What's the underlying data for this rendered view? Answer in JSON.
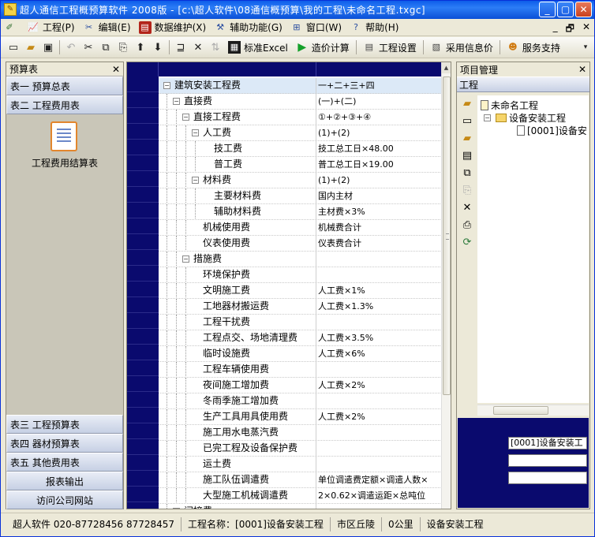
{
  "window": {
    "title": "超人通信工程概预算软件 2008版 - [c:\\超人软件\\08通信概预算\\我的工程\\未命名工程.txgc]",
    "icon": "app-icon"
  },
  "menu": {
    "items": [
      {
        "label": "工程(P)",
        "icon": "project-icon"
      },
      {
        "label": "编辑(E)",
        "icon": "edit-icon"
      },
      {
        "label": "数据维护(X)",
        "icon": "book-icon"
      },
      {
        "label": "辅助功能(G)",
        "icon": "tools-icon"
      },
      {
        "label": "窗口(W)",
        "icon": "window-icon"
      },
      {
        "label": "帮助(H)",
        "icon": "help-icon"
      }
    ],
    "mdi_controls": [
      "_",
      "🗗",
      "✕"
    ]
  },
  "toolbar": {
    "buttons": [
      {
        "label": "标准Excel",
        "icon": "excel-icon"
      },
      {
        "label": "造价计算",
        "icon": "play-icon"
      },
      {
        "label": "工程设置",
        "icon": "settings-icon"
      },
      {
        "label": "采用信息价",
        "icon": "price-icon"
      },
      {
        "label": "服务支持",
        "icon": "support-icon"
      }
    ]
  },
  "left_panel": {
    "title": "预算表",
    "top_tabs": [
      "表一 预算总表",
      "表二 工程费用表"
    ],
    "doc_label": "工程费用结算表",
    "bottom_tabs": [
      "表三 工程预算表",
      "表四 器材预算表",
      "表五 其他费用表",
      "报表输出",
      "访问公司网站"
    ]
  },
  "grid": {
    "rows": [
      {
        "name": "建筑安装工程费",
        "formula": "一+二+三+四",
        "level": 0,
        "exp": "−",
        "selected": true
      },
      {
        "name": "直接费",
        "formula": "(一)+(二)",
        "level": 1,
        "exp": "−"
      },
      {
        "name": "直接工程费",
        "formula": "①+②+③+④",
        "level": 2,
        "exp": "−"
      },
      {
        "name": "人工费",
        "formula": "(1)+(2)",
        "level": 3,
        "exp": "−"
      },
      {
        "name": "技工费",
        "formula": "技工总工日×48.00",
        "level": 4
      },
      {
        "name": "普工费",
        "formula": "普工总工日×19.00",
        "level": 4
      },
      {
        "name": "材料费",
        "formula": "(1)+(2)",
        "level": 3,
        "exp": "−"
      },
      {
        "name": "主要材料费",
        "formula": "国内主材",
        "level": 4
      },
      {
        "name": "辅助材料费",
        "formula": "主材费×3%",
        "level": 4
      },
      {
        "name": "机械使用费",
        "formula": "机械费合计",
        "level": 3
      },
      {
        "name": "仪表使用费",
        "formula": "仪表费合计",
        "level": 3
      },
      {
        "name": "措施费",
        "formula": "",
        "level": 2,
        "exp": "−"
      },
      {
        "name": "环境保护费",
        "formula": "",
        "level": 3
      },
      {
        "name": "文明施工费",
        "formula": "人工费×1%",
        "level": 3
      },
      {
        "name": "工地器材搬运费",
        "formula": "人工费×1.3%",
        "level": 3
      },
      {
        "name": "工程干扰费",
        "formula": "",
        "level": 3
      },
      {
        "name": "工程点交、场地清理费",
        "formula": "人工费×3.5%",
        "level": 3
      },
      {
        "name": "临时设施费",
        "formula": "人工费×6%",
        "level": 3
      },
      {
        "name": "工程车辆使用费",
        "formula": "",
        "level": 3
      },
      {
        "name": "夜间施工增加费",
        "formula": "人工费×2%",
        "level": 3
      },
      {
        "name": "冬雨季施工增加费",
        "formula": "",
        "level": 3
      },
      {
        "name": "生产工具用具使用费",
        "formula": "人工费×2%",
        "level": 3
      },
      {
        "name": "施工用水电蒸汽费",
        "formula": "",
        "level": 3
      },
      {
        "name": "已完工程及设备保护费",
        "formula": "",
        "level": 3
      },
      {
        "name": "运土费",
        "formula": "",
        "level": 3
      },
      {
        "name": "施工队伍调遣费",
        "formula": "单位调遣费定额×调遣人数×",
        "level": 3
      },
      {
        "name": "大型施工机械调遣费",
        "formula": "2×0.62×调遣运距×总吨位",
        "level": 3
      },
      {
        "name": "间接费",
        "formula": "",
        "level": 1,
        "exp": "−"
      }
    ]
  },
  "right_panel": {
    "title": "项目管理",
    "subtitle": "工程",
    "tree": [
      {
        "label": "未命名工程",
        "icon": "project-node-icon"
      },
      {
        "label": "设备安装工程",
        "icon": "folder-icon"
      },
      {
        "label": "[0001]设备安",
        "icon": "document-icon"
      }
    ],
    "property_value": "[0001]设备安装工"
  },
  "statusbar": {
    "cells": [
      "超人软件 020-87728456 87728457",
      "工程名称：[0001]设备安装工程",
      "市区丘陵",
      "0公里",
      "设备安装工程"
    ]
  }
}
